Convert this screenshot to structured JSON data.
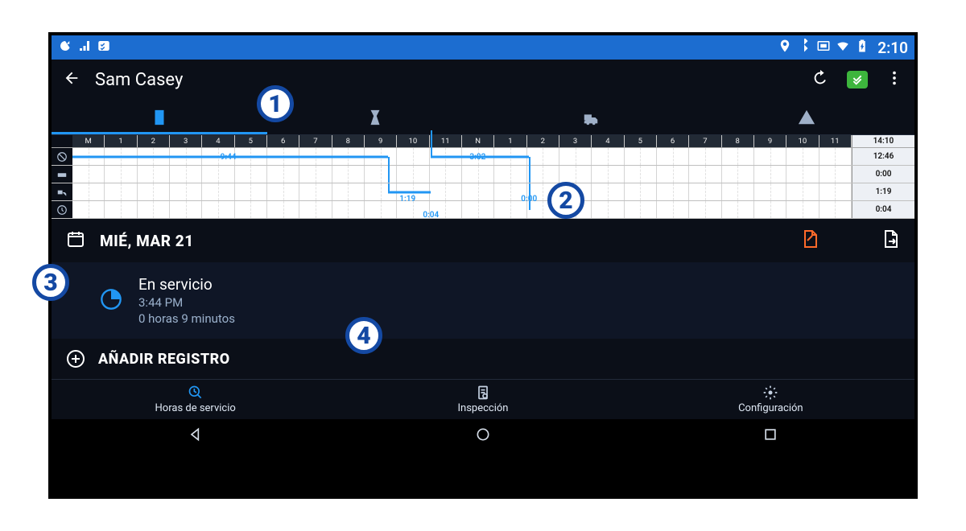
{
  "statusbar": {
    "time": "2:10"
  },
  "header": {
    "driver_name": "Sam Casey"
  },
  "timeline": {
    "hours": [
      "M",
      "1",
      "2",
      "3",
      "4",
      "5",
      "6",
      "7",
      "8",
      "9",
      "10",
      "11",
      "N",
      "1",
      "2",
      "3",
      "4",
      "5",
      "6",
      "7",
      "8",
      "9",
      "10",
      "11"
    ],
    "header_value": "14:10",
    "rows": [
      {
        "name": "off-duty",
        "value": "12:46",
        "segment_label": "9:44"
      },
      {
        "name": "sleeper",
        "value": "0:00"
      },
      {
        "name": "driving",
        "value": "1:19",
        "segment_label": "1:19",
        "segment_label2": "3:02"
      },
      {
        "name": "on-duty",
        "value": "0:04",
        "segment_label": "0:04",
        "segment_label2": "0:00"
      }
    ]
  },
  "date": {
    "label": "MIÉ, MAR 21"
  },
  "entry": {
    "status": "En servicio",
    "time": "3:44 PM",
    "duration": "0 horas 9 minutos"
  },
  "add_record": {
    "label": "AÑADIR REGISTRO"
  },
  "bottom_tabs": [
    {
      "label": "Horas de servicio",
      "active": true
    },
    {
      "label": "Inspección"
    },
    {
      "label": "Configuración"
    }
  ],
  "callouts": [
    "1",
    "2",
    "3",
    "4"
  ]
}
